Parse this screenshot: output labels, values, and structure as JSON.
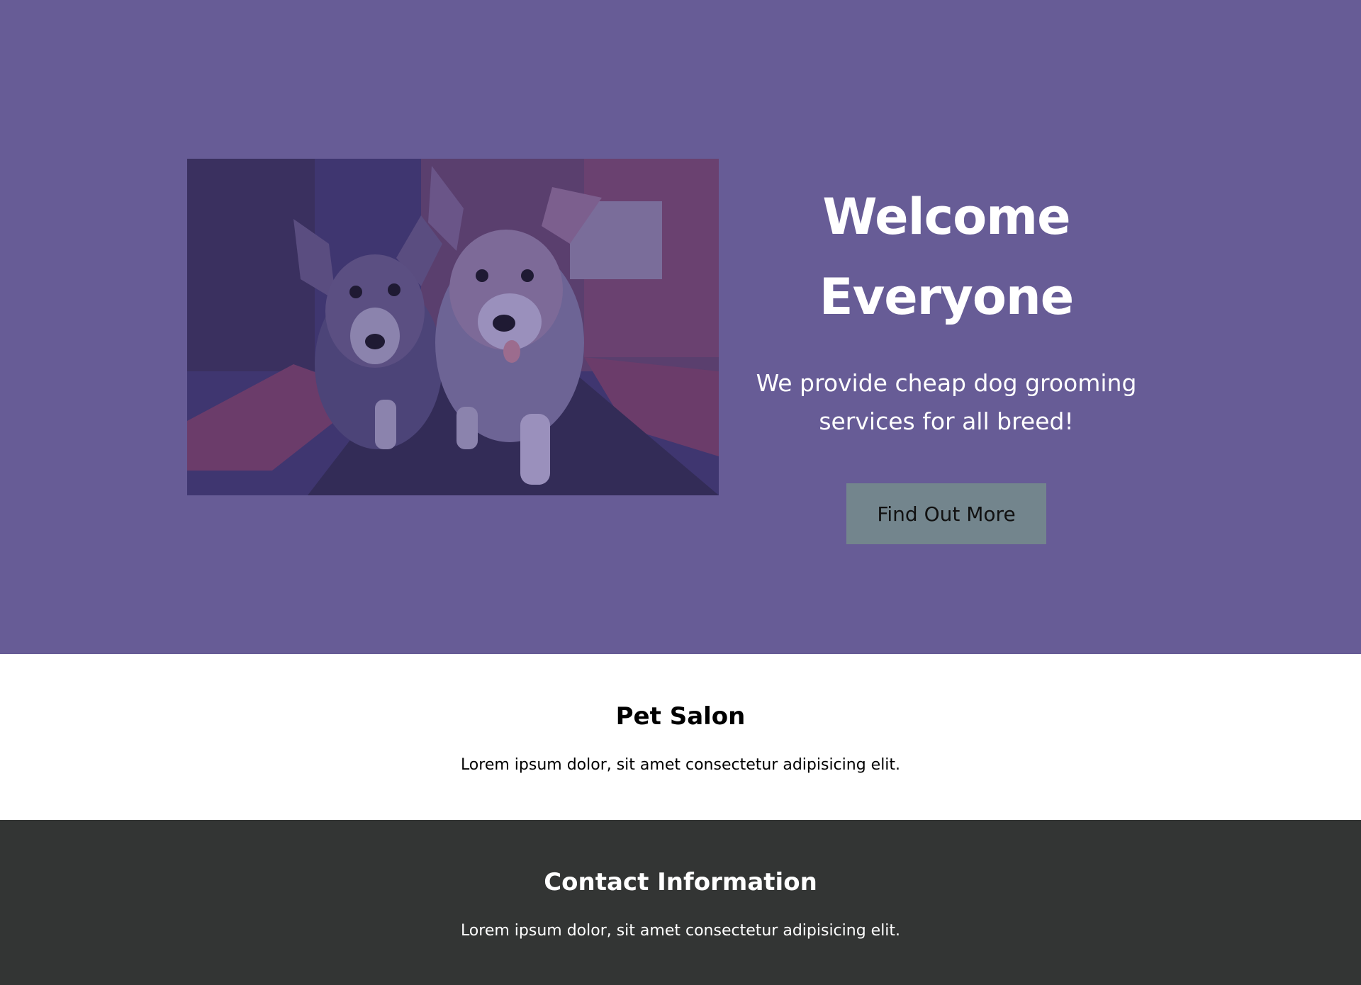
{
  "hero": {
    "image_alt": "Two corgi puppies",
    "title_line1": "Welcome",
    "title_line2": "Everyone",
    "subtitle": "We provide cheap dog grooming services for all breed!",
    "button_label": "Find Out More",
    "background_color": "#675c96",
    "button_color": "#73858d"
  },
  "salon": {
    "heading": "Pet Salon",
    "text": "Lorem ipsum dolor, sit amet consectetur adipisicing elit."
  },
  "contact": {
    "heading": "Contact Information",
    "text": "Lorem ipsum dolor, sit amet consectetur adipisicing elit.",
    "background_color": "#333534"
  }
}
